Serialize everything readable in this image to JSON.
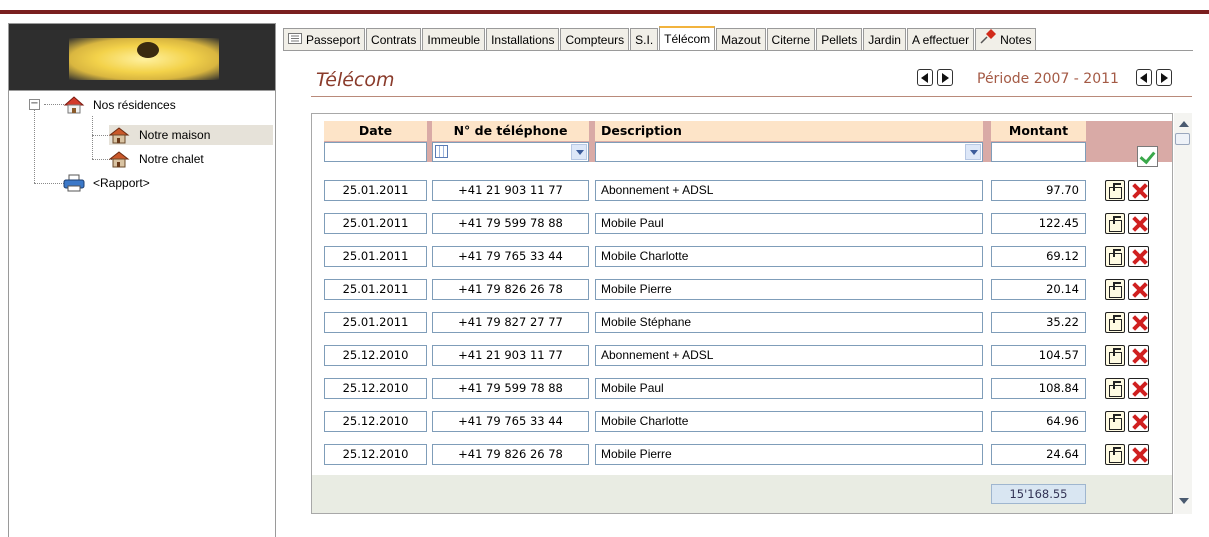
{
  "tree": {
    "root_label": "Nos résidences",
    "children": [
      "Notre maison",
      "Notre chalet"
    ],
    "report_label": "<Rapport>",
    "expander": "−"
  },
  "tabs": [
    {
      "label": "Passeport",
      "icon": "list-icon"
    },
    {
      "label": "Contrats"
    },
    {
      "label": "Immeuble"
    },
    {
      "label": "Installations"
    },
    {
      "label": "Compteurs"
    },
    {
      "label": "S.I."
    },
    {
      "label": "Télécom",
      "active": true
    },
    {
      "label": "Mazout"
    },
    {
      "label": "Citerne"
    },
    {
      "label": "Pellets"
    },
    {
      "label": "Jardin"
    },
    {
      "label": "A effectuer"
    },
    {
      "label": "Notes",
      "icon": "pin-icon"
    }
  ],
  "section": {
    "title": "Télécom",
    "periode": "Période 2007 - 2011"
  },
  "grid": {
    "columns": {
      "date": "Date",
      "phone": "N° de téléphone",
      "description": "Description",
      "amount": "Montant"
    },
    "rows": [
      {
        "date": "25.01.2011",
        "phone": "+41 21 903 11 77",
        "description": "Abonnement + ADSL",
        "amount": "97.70"
      },
      {
        "date": "25.01.2011",
        "phone": "+41 79 599 78 88",
        "description": "Mobile Paul",
        "amount": "122.45"
      },
      {
        "date": "25.01.2011",
        "phone": "+41 79 765 33 44",
        "description": "Mobile Charlotte",
        "amount": "69.12"
      },
      {
        "date": "25.01.2011",
        "phone": "+41 79 826 26 78",
        "description": "Mobile Pierre",
        "amount": "20.14"
      },
      {
        "date": "25.01.2011",
        "phone": "+41 79 827 27 77",
        "description": "Mobile Stéphane",
        "amount": "35.22"
      },
      {
        "date": "25.12.2010",
        "phone": "+41 21 903 11 77",
        "description": "Abonnement + ADSL",
        "amount": "104.57"
      },
      {
        "date": "25.12.2010",
        "phone": "+41 79 599 78 88",
        "description": "Mobile Paul",
        "amount": "108.84"
      },
      {
        "date": "25.12.2010",
        "phone": "+41 79 765 33 44",
        "description": "Mobile Charlotte",
        "amount": "64.96"
      },
      {
        "date": "25.12.2010",
        "phone": "+41 79 826 26 78",
        "description": "Mobile Pierre",
        "amount": "24.64"
      }
    ],
    "total": "15'168.55"
  },
  "colors": {
    "accent_red": "#7a1f1f",
    "title_color": "#8a3b2b",
    "header_bg": "#fde4c8",
    "header_band": "#d9aaa6",
    "field_border": "#7f9db9",
    "active_tab_top": "#f2b33d"
  }
}
